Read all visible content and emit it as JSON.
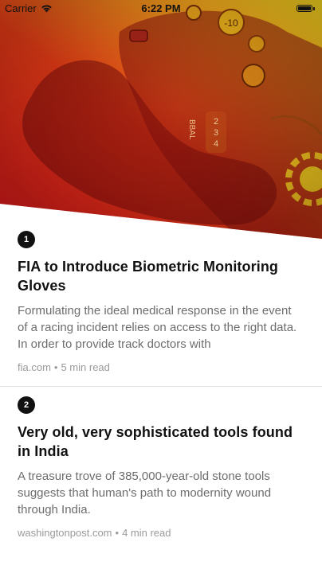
{
  "status_bar": {
    "carrier": "Carrier",
    "time": "6:22 PM"
  },
  "hero": {
    "image_icon": "racing-steering-wheel-gloved-hand-image",
    "gradient": [
      "#e8201c",
      "#f6d11d"
    ]
  },
  "articles": [
    {
      "rank": "1",
      "title": "FIA to Introduce Biometric Monitoring Gloves",
      "summary": "Formulating the ideal medical response in the event of a racing incident relies on access to the right data. In order to provide track doctors with",
      "source": "fia.com",
      "separator": "•",
      "read_time": "5 min read"
    },
    {
      "rank": "2",
      "title": "Very old, very sophisticated tools found in India",
      "summary": "A treasure trove of 385,000-year-old stone tools suggests that human's path to modernity wound through India.",
      "source": "washingtonpost.com",
      "separator": "•",
      "read_time": "4 min read"
    }
  ]
}
